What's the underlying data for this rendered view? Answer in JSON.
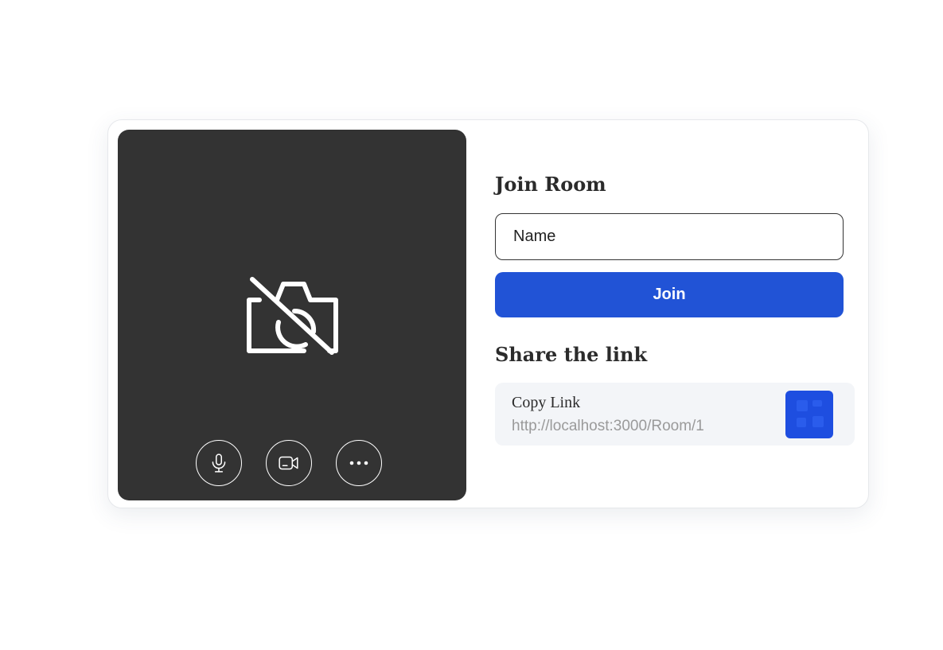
{
  "join": {
    "title": "Join Room",
    "name_placeholder": "Name",
    "join_label": "Join"
  },
  "share": {
    "title": "Share the link",
    "copy_label": "Copy Link",
    "url": "http://localhost:3000/Room/1"
  },
  "preview": {
    "camera_state_icon": "camera-off-icon",
    "controls": [
      {
        "icon": "microphone-icon"
      },
      {
        "icon": "video-camera-icon"
      },
      {
        "icon": "more-options-icon"
      }
    ]
  },
  "colors": {
    "accent": "#2153d6",
    "qr_accent": "#1e4ee0",
    "preview_background": "#333333",
    "share_background": "#f3f5f8"
  }
}
